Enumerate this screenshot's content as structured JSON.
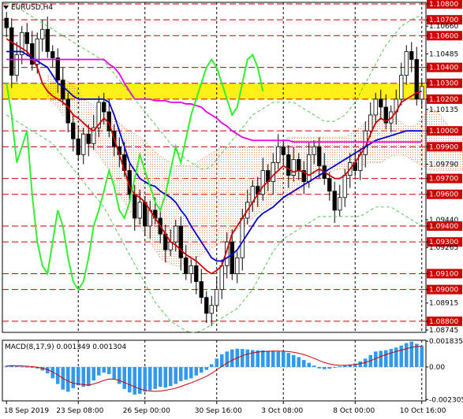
{
  "window": {
    "title": "EURUSD,H4",
    "menu_icon": "dropdown-triangle-icon"
  },
  "colors": {
    "background": "#ffffff",
    "axis": "#000000",
    "grid": "#000000",
    "candle": "#000000",
    "red_line": "#cc0000",
    "price_label_bg": "#cc0000",
    "price_label_text": "#ffffff",
    "highlight_zone": "#ffee00",
    "tenkan": "#cc0000",
    "kijun": "#0000cc",
    "senkou_b": "#e600e6",
    "chikou": "#33ee33",
    "bollinger": "#33bb33",
    "cloud": "#e08050",
    "macd_hist": "#3399ee",
    "macd_signal": "#cc0000"
  },
  "chart_data": [
    {
      "type": "candlestick",
      "symbol": "EURUSD",
      "timeframe": "H4",
      "y_axis_ticks": [
        "1.10800",
        "1.10700",
        "1.10660",
        "1.10600",
        "1.10485",
        "1.10400",
        "1.10300",
        "1.10200",
        "1.10135",
        "1.10000",
        "1.09900",
        "1.09790",
        "1.09700",
        "1.09600",
        "1.09440",
        "1.09400",
        "1.09300",
        "1.09265",
        "1.09100",
        "1.09000",
        "1.08915",
        "1.08800",
        "1.08745"
      ],
      "key_levels": [
        1.108,
        1.107,
        1.106,
        1.104,
        1.103,
        1.102,
        1.1,
        1.099,
        1.097,
        1.096,
        1.094,
        1.093,
        1.091,
        1.09,
        1.088
      ],
      "highlight_zone": [
        1.102,
        1.103
      ],
      "ylim": [
        1.0873,
        1.1081
      ],
      "x_axis_labels": [
        "18 Sep 2019",
        "23 Sep 08:00",
        "26 Sep 00:00",
        "30 Sep 16:00",
        "3 Oct 08:00",
        "8 Oct 00:00",
        "10 Oct 16:00"
      ],
      "close": [
        1.1065,
        1.1035,
        1.1048,
        1.1062,
        1.1055,
        1.1042,
        1.1058,
        1.1064,
        1.105,
        1.1046,
        1.1032,
        1.102,
        1.1005,
        1.0995,
        1.0985,
        1.0998,
        1.0992,
        1.1002,
        1.1018,
        1.1012,
        1.1,
        1.099,
        1.0985,
        1.0975,
        1.096,
        1.0945,
        1.0955,
        1.094,
        1.095,
        1.0945,
        1.0935,
        1.0925,
        1.093,
        1.094,
        1.092,
        1.091,
        1.0915,
        1.0905,
        1.0895,
        1.0885,
        1.089,
        1.09,
        1.0915,
        1.093,
        1.091,
        1.092,
        1.0945,
        1.0955,
        1.0965,
        1.096,
        1.0975,
        1.0968,
        1.098,
        1.099,
        1.0985,
        1.0972,
        1.0982,
        1.0975,
        1.0968,
        1.0985,
        1.099,
        1.0978,
        1.097,
        1.0962,
        1.095,
        1.0958,
        1.0972,
        1.098,
        1.0975,
        1.0985,
        1.1,
        1.101,
        1.102,
        1.1015,
        1.1005,
        1.1012,
        1.102,
        1.1035,
        1.105,
        1.1045,
        1.102,
        1.1028
      ],
      "series": [
        {
          "name": "Tenkan-sen",
          "values": [
            1.1058,
            1.1056,
            1.1054,
            1.1052,
            1.105,
            1.1046,
            1.104,
            1.103,
            1.1025,
            1.1022,
            1.102,
            1.1018,
            1.1015,
            1.101,
            1.1008,
            1.1005,
            1.1002,
            1.1,
            1.1004,
            1.1008,
            1.1005,
            1.0995,
            1.0985,
            1.0975,
            1.0965,
            1.096,
            1.0958,
            1.0955,
            1.095,
            1.0945,
            1.094,
            1.0935,
            1.093,
            1.0928,
            1.0925,
            1.0922,
            1.092,
            1.0918,
            1.0915,
            1.0912,
            1.091,
            1.0912,
            1.0915,
            1.0925,
            1.0935,
            1.094,
            1.0945,
            1.095,
            1.0955,
            1.096,
            1.0965,
            1.0968,
            1.0972,
            1.0975,
            1.0978,
            1.0976,
            1.0974,
            1.0975,
            1.0974,
            1.0972,
            1.0974,
            1.0976,
            1.0974,
            1.0972,
            1.097,
            1.097,
            1.0972,
            1.0976,
            1.098,
            1.0985,
            1.099,
            1.0998,
            1.1005,
            1.1008,
            1.1006,
            1.1008,
            1.1012,
            1.1018,
            1.102,
            1.1022,
            1.1024,
            1.1025
          ]
        },
        {
          "name": "Kijun-sen",
          "values": [
            1.105,
            1.105,
            1.105,
            1.105,
            1.1048,
            1.1046,
            1.1044,
            1.1042,
            1.104,
            1.1035,
            1.103,
            1.1028,
            1.1025,
            1.1022,
            1.102,
            1.102,
            1.102,
            1.102,
            1.102,
            1.102,
            1.1018,
            1.101,
            1.1,
            1.099,
            1.098,
            1.0975,
            1.097,
            1.0968,
            1.0966,
            1.0965,
            1.0962,
            1.096,
            1.0958,
            1.0955,
            1.095,
            1.0946,
            1.094,
            1.0935,
            1.093,
            1.0925,
            1.092,
            1.0918,
            1.0918,
            1.092,
            1.0922,
            1.0925,
            1.093,
            1.0935,
            1.094,
            1.0945,
            1.0948,
            1.095,
            1.0952,
            1.0955,
            1.0958,
            1.096,
            1.0962,
            1.0964,
            1.0966,
            1.0968,
            1.097,
            1.0972,
            1.0974,
            1.0976,
            1.0978,
            1.098,
            1.0982,
            1.0984,
            1.0986,
            1.0988,
            1.099,
            1.0992,
            1.0994,
            1.0995,
            1.0996,
            1.0997,
            1.0998,
            1.0999,
            1.1,
            1.1,
            1.1,
            1.1
          ]
        },
        {
          "name": "Senkou Span B",
          "values": [
            1.1045,
            1.1045,
            1.1045,
            1.1045,
            1.1045,
            1.1045,
            1.1045,
            1.1045,
            1.1045,
            1.1045,
            1.1045,
            1.1045,
            1.1045,
            1.1045,
            1.1045,
            1.1045,
            1.1045,
            1.1045,
            1.1045,
            1.1045,
            1.1042,
            1.104,
            1.1036,
            1.103,
            1.1025,
            1.102,
            1.102,
            1.102,
            1.102,
            1.1019,
            1.1019,
            1.1019,
            1.1018,
            1.1018,
            1.1018,
            1.1017,
            1.1017,
            1.1016,
            1.1015,
            1.1012,
            1.101,
            1.1008,
            1.1005,
            1.1003,
            1.1,
            1.0998,
            1.0996,
            1.0995,
            1.0994,
            1.0994,
            1.0994,
            1.0994,
            1.0994,
            1.0994,
            1.0994,
            1.0994,
            1.0993,
            1.0993,
            1.0993,
            1.0993,
            1.0993,
            1.0993,
            1.0993,
            1.0993,
            1.0993,
            1.0993,
            1.0993,
            1.0993,
            1.0993,
            1.0993,
            1.0993,
            1.0993,
            1.0993,
            1.0993,
            1.0993,
            1.0993,
            1.0993,
            1.0993,
            1.0993,
            1.0993,
            1.0993,
            1.0993
          ]
        },
        {
          "name": "Chikou Span",
          "values": [
            1.103,
            1.101,
            1.098,
            1.099,
            1.1,
            1.096,
            1.093,
            1.0915,
            1.091,
            1.093,
            1.095,
            1.094,
            1.092,
            1.0905,
            1.09,
            1.0905,
            1.092,
            1.094,
            1.095,
            1.0962,
            1.0975,
            1.0965,
            1.095,
            1.0945,
            1.0955,
            1.097,
            1.0985,
            1.0975,
            1.0965,
            1.0955,
            1.095,
            1.096,
            1.0975,
            1.099,
            1.098,
            1.0995,
            1.101,
            1.102,
            1.103,
            1.104,
            1.1045,
            1.104,
            1.103,
            1.102,
            1.101,
            1.1015,
            1.103,
            1.1045,
            1.1048,
            1.104,
            1.1025
          ]
        },
        {
          "name": "Bollinger Upper",
          "values": [
            1.108,
            1.108,
            1.1078,
            1.1076,
            1.1074,
            1.1072,
            1.107,
            1.1068,
            1.1066,
            1.1064,
            1.1062,
            1.106,
            1.1058,
            1.1056,
            1.1054,
            1.1052,
            1.105,
            1.1048,
            1.1046,
            1.1044,
            1.104,
            1.1036,
            1.1032,
            1.1028,
            1.1024,
            1.102,
            1.1016,
            1.1012,
            1.1008,
            1.1004,
            1.1,
            1.0996,
            1.0992,
            1.0988,
            1.0985,
            1.0982,
            1.098,
            1.0978,
            1.0976,
            1.0976,
            1.0978,
            1.0982,
            1.0986,
            1.099,
            1.0994,
            1.0998,
            1.1002,
            1.1006,
            1.101,
            1.1012,
            1.1014,
            1.1016,
            1.1018,
            1.1018,
            1.1018,
            1.1018,
            1.1018,
            1.1016,
            1.1014,
            1.1012,
            1.101,
            1.1008,
            1.1006,
            1.1006,
            1.1006,
            1.1008,
            1.101,
            1.1014,
            1.1018,
            1.1024,
            1.103,
            1.1036,
            1.1042,
            1.1048,
            1.1054,
            1.1058,
            1.1062,
            1.1066,
            1.1068,
            1.107,
            1.1072,
            1.1072
          ]
        },
        {
          "name": "Bollinger Lower",
          "values": [
            1.101,
            1.1008,
            1.1006,
            1.1004,
            1.1002,
            1.1,
            1.0998,
            1.0996,
            1.0994,
            1.0992,
            1.0988,
            1.0984,
            1.098,
            1.0976,
            1.0972,
            1.0968,
            1.0964,
            1.096,
            1.0956,
            1.0952,
            1.0946,
            1.094,
            1.0934,
            1.0928,
            1.0922,
            1.0916,
            1.091,
            1.0904,
            1.0898,
            1.0892,
            1.0888,
            1.0884,
            1.088,
            1.0878,
            1.0876,
            1.0874,
            1.0873,
            1.0873,
            1.0874,
            1.0876,
            1.0878,
            1.088,
            1.0882,
            1.0884,
            1.0886,
            1.0888,
            1.0892,
            1.0896,
            1.09,
            1.0906,
            1.0912,
            1.0918,
            1.0924,
            1.0928,
            1.0932,
            1.0934,
            1.0936,
            1.0938,
            1.094,
            1.0942,
            1.0944,
            1.0946,
            1.0946,
            1.0946,
            1.0946,
            1.0946,
            1.0946,
            1.0946,
            1.0946,
            1.0946,
            1.0948,
            1.095,
            1.0952,
            1.0952,
            1.0952,
            1.0952,
            1.095,
            1.0948,
            1.0946,
            1.0944,
            1.0942,
            1.094
          ]
        }
      ],
      "cloud": {
        "upper": [
          1.1035,
          1.1035,
          1.1035,
          1.1033,
          1.1031,
          1.1028,
          1.1025,
          1.102,
          1.1018,
          1.1016,
          1.1015,
          1.1013,
          1.101,
          1.1008,
          1.1005,
          1.1002,
          1.1,
          1.0998,
          1.0996,
          1.0993,
          1.099,
          1.0987,
          1.0984,
          1.0982,
          1.098,
          1.0978,
          1.0978,
          1.0978,
          1.0978,
          1.098,
          1.0982,
          1.0984,
          1.0986,
          1.0988,
          1.099,
          1.099,
          1.099,
          1.099,
          1.099,
          1.099,
          1.099,
          1.099,
          1.099,
          1.099,
          1.099,
          1.0992,
          1.0994,
          1.0996,
          1.0996,
          1.0996,
          1.0996,
          1.0996,
          1.0996,
          1.0996,
          1.0996,
          1.0996,
          1.0996,
          1.0996,
          1.0996,
          1.0998,
          1.1,
          1.1002,
          1.1005,
          1.1008,
          1.101,
          1.1012,
          1.1012,
          1.101,
          1.1008,
          1.1005,
          1.1003,
          1.1003,
          1.1004,
          1.1008,
          1.1012,
          1.1014,
          1.1012,
          1.1008,
          1.1004,
          1.1,
          1.0998,
          1.0996
        ],
        "lower": [
          1.102,
          1.1018,
          1.1015,
          1.101,
          1.1008,
          1.1005,
          1.1,
          1.0996,
          1.0992,
          1.0988,
          1.0985,
          1.098,
          1.0975,
          1.0968,
          1.096,
          1.0955,
          1.095,
          1.0945,
          1.094,
          1.0935,
          1.093,
          1.0925,
          1.092,
          1.0918,
          1.0916,
          1.0915,
          1.0915,
          1.0916,
          1.0918,
          1.092,
          1.0922,
          1.0924,
          1.0926,
          1.0928,
          1.093,
          1.0932,
          1.0935,
          1.0938,
          1.094,
          1.0942,
          1.0945,
          1.0948,
          1.095,
          1.0952,
          1.0954,
          1.0955,
          1.0956,
          1.0958,
          1.096,
          1.0962,
          1.0964,
          1.0966,
          1.0968,
          1.097,
          1.0972,
          1.0974,
          1.0975,
          1.0976,
          1.0976,
          1.0976,
          1.0977,
          1.0978,
          1.0979,
          1.098,
          1.098,
          1.098,
          1.0982,
          1.0984,
          1.0985,
          1.0985,
          1.0984,
          1.0982,
          1.098,
          1.0978,
          1.0976,
          1.0975,
          1.0975,
          1.0975,
          1.0975,
          1.0975,
          1.0975,
          1.0975
        ]
      }
    },
    {
      "type": "bar",
      "indicator": "MACD",
      "label": "MACD(8,17,9) 0.001349 0.001304",
      "y_axis_ticks": [
        "0.001835",
        "0.00",
        "-0.002305"
      ],
      "ylim": [
        -0.0024,
        0.0019
      ],
      "x_axis_labels": [
        "18 Sep 2019",
        "23 Sep 08:00",
        "26 Sep 00:00",
        "30 Sep 16:00",
        "3 Oct 08:00",
        "8 Oct 00:00",
        "10 Oct 16:00"
      ],
      "values": [
        8e-05,
        0.00012,
        6e-05,
        4e-05,
        2e-05,
        -5e-05,
        -0.0001,
        -0.00025,
        -0.00045,
        -0.0008,
        -0.0012,
        -0.0016,
        -0.00175,
        -0.0015,
        -0.0013,
        -0.0014,
        -0.00135,
        -0.00095,
        -0.0006,
        -0.0004,
        -0.0005,
        -0.00085,
        -0.0012,
        -0.00155,
        -0.0018,
        -0.00195,
        -0.0019,
        -0.00175,
        -0.00165,
        -0.00155,
        -0.0014,
        -0.00145,
        -0.00135,
        -0.0012,
        -0.001,
        -0.0009,
        -0.0008,
        -0.0006,
        -0.0004,
        -0.0002,
        0.0002,
        0.0006,
        0.0009,
        0.0011,
        0.00125,
        0.0013,
        0.00128,
        0.00125,
        0.0012,
        0.00118,
        0.00118,
        0.00115,
        0.00112,
        0.0011,
        0.00108,
        0.001,
        0.00085,
        0.0007,
        0.0005,
        0.0003,
        0.0001,
        -0.0001,
        -0.00015,
        -0.00012,
        -5e-05,
        5e-05,
        0.00012,
        0.00018,
        0.00025,
        0.0004,
        0.0006,
        0.00085,
        0.0011,
        0.00115,
        0.0012,
        0.00128,
        0.00138,
        0.00152,
        0.0017,
        0.0018,
        0.00165,
        0.0015
      ],
      "signal": [
        8e-05,
        0.0001,
        9e-05,
        8e-05,
        6e-05,
        3e-05,
        -1e-05,
        -8e-05,
        -0.00018,
        -0.00035,
        -0.00055,
        -0.0008,
        -0.001,
        -0.00115,
        -0.0012,
        -0.00125,
        -0.00128,
        -0.0012,
        -0.00108,
        -0.00095,
        -0.00085,
        -0.00086,
        -0.00095,
        -0.0011,
        -0.00125,
        -0.0014,
        -0.00155,
        -0.00165,
        -0.0017,
        -0.00172,
        -0.0017,
        -0.00165,
        -0.00158,
        -0.0015,
        -0.00138,
        -0.00125,
        -0.00112,
        -0.00098,
        -0.00082,
        -0.00066,
        -0.00045,
        -0.0002,
        5e-05,
        0.00028,
        0.00048,
        0.00065,
        0.0008,
        0.00092,
        0.001,
        0.00106,
        0.0011,
        0.00112,
        0.00113,
        0.00113,
        0.00112,
        0.0011,
        0.00105,
        0.00098,
        0.00088,
        0.00076,
        0.00062,
        0.00046,
        0.00032,
        0.00022,
        0.00015,
        0.00012,
        0.00012,
        0.00014,
        0.00018,
        0.00024,
        0.00032,
        0.00045,
        0.0006,
        0.00075,
        0.00088,
        0.001,
        0.0011,
        0.0012,
        0.0013,
        0.0014,
        0.00145,
        0.00148
      ]
    }
  ]
}
